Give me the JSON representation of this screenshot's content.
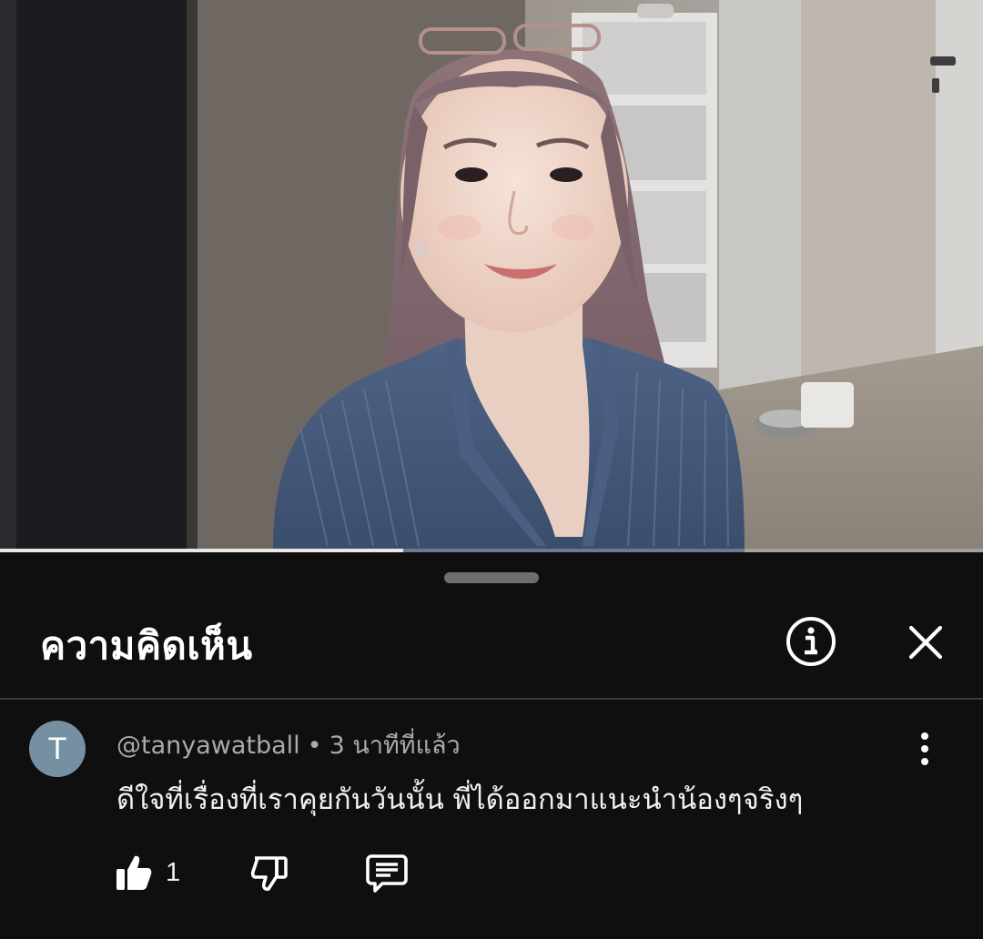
{
  "video": {
    "progress_fraction": 0.41
  },
  "comments_panel": {
    "title": "ความคิดเห็น",
    "info_icon": "info-circle-icon",
    "close_icon": "close-icon"
  },
  "comment": {
    "avatar_letter": "T",
    "avatar_color": "#7590a2",
    "author": "@tanyawatball",
    "separator": "•",
    "time": "3 นาทีที่แล้ว",
    "text": "ดีใจที่เรื่องที่เราคุยกันวันนั้น พี่ได้ออกมาแนะนำน้องๆจริงๆ",
    "like_count": "1",
    "icons": {
      "like": "thumbs-up-icon",
      "dislike": "thumbs-down-icon",
      "reply": "reply-icon",
      "more": "more-vertical-icon"
    }
  },
  "colors": {
    "background": "#0f0f0f",
    "text_primary": "#f1f1f1",
    "text_secondary": "#aaaaaa"
  }
}
